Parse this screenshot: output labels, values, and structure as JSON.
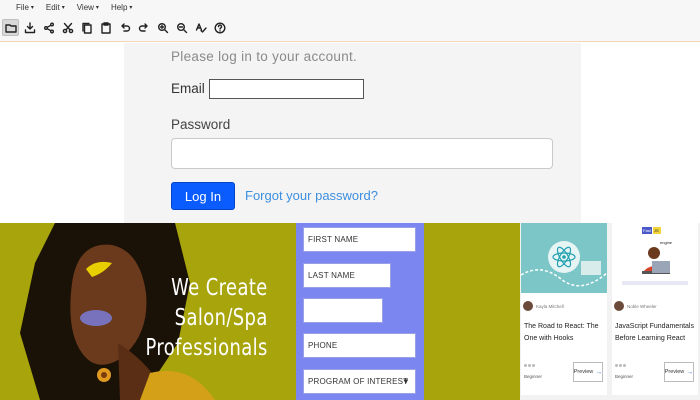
{
  "menubar": {
    "items": [
      {
        "label": "File"
      },
      {
        "label": "Edit"
      },
      {
        "label": "View"
      },
      {
        "label": "Help"
      }
    ]
  },
  "toolbar": {
    "icons": [
      "folder-icon",
      "download-icon",
      "share-icon",
      "cut-icon",
      "copy-icon",
      "paste-icon",
      "undo-icon",
      "redo-icon",
      "zoom-in-icon",
      "zoom-out-icon",
      "spellcheck-icon",
      "help-icon"
    ]
  },
  "login": {
    "intro": "Please log in to your account.",
    "email_label": "Email",
    "email_value": "",
    "password_label": "Password",
    "password_value": "",
    "login_button": "Log In",
    "forgot_link": "Forgot your password?",
    "accent": "#0a5cff"
  },
  "banner": {
    "headline_lines": [
      "We Create",
      "Salon/Spa",
      "Professionals"
    ],
    "fields": {
      "first_name": "FIRST NAME",
      "last_name": "LAST NAME",
      "blank": "",
      "phone": "PHONE",
      "program": "PROGRAM OF INTEREST"
    },
    "colors": {
      "background": "#a8a40c",
      "form": "#7b86f0"
    }
  },
  "cards": [
    {
      "author": "Kayla Mitchell",
      "title": "The Road to React: The One with Hooks",
      "level": "Beginner",
      "preview": "Preview",
      "thumb_icon": "react-logo-icon"
    },
    {
      "author": "Noble Wheeler",
      "title": "JavaScript Fundamentals Before Learning React",
      "level": "Beginner",
      "preview": "Preview",
      "thumb_badges": [
        "Fast",
        "JS"
      ],
      "thumb_caption": "engine",
      "thumb_icon": "developer-at-laptop-icon"
    }
  ]
}
